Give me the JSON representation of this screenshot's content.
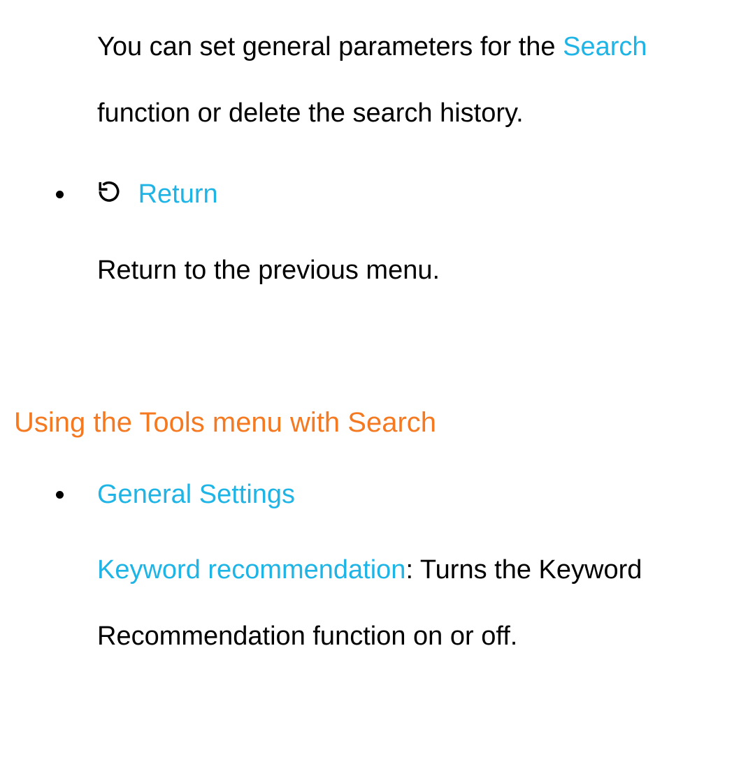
{
  "section1": {
    "items": [
      {
        "desc_part1": "You can set general parameters for the ",
        "desc_link": "Search",
        "desc_part2": " function or delete the search history."
      },
      {
        "title_link": "Return",
        "desc": "Return to the previous menu."
      }
    ]
  },
  "heading": "Using the Tools menu with Search",
  "section2": {
    "items": [
      {
        "title_link": "General Settings",
        "desc_link": "Keyword recommendation",
        "desc_rest": ": Turns the Keyword Recommendation function on or off."
      }
    ]
  }
}
